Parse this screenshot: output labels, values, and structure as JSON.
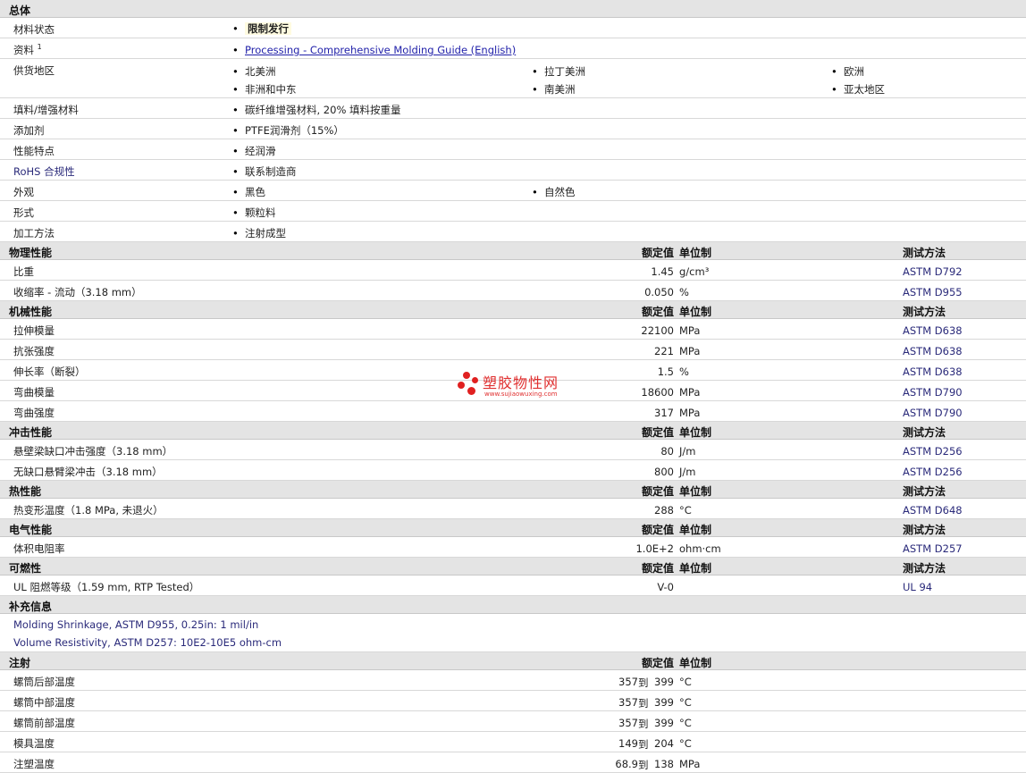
{
  "colors": {
    "section_bg": "#e4e4e4",
    "link": "#2222aa",
    "accent_text": "#2a2a7a",
    "watermark": "#e02020"
  },
  "overview": {
    "title": "总体",
    "status_label": "材料状态",
    "status_value": "限制发行",
    "docs_label": "资料",
    "docs_sup": "1",
    "docs_link": "Processing - Comprehensive Molding Guide (English)",
    "regions_label": "供货地区",
    "regions": [
      "北美洲",
      "拉丁美洲",
      "欧洲",
      "非洲和中东",
      "南美洲",
      "亚太地区"
    ],
    "filler_label": "填料/增强材料",
    "filler_value": "碳纤维增强材料, 20% 填料按重量",
    "additive_label": "添加剂",
    "additive_value": "PTFE润滑剂（15%）",
    "feature_label": "性能特点",
    "feature_value": "经润滑",
    "rohs_label": "RoHS 合规性",
    "rohs_value": "联系制造商",
    "appearance_label": "外观",
    "appearance_values": [
      "黑色",
      "自然色"
    ],
    "form_label": "形式",
    "form_value": "颗粒料",
    "process_label": "加工方法",
    "process_value": "注射成型"
  },
  "headers": {
    "value": "额定值",
    "unit": "单位制",
    "method": "测试方法"
  },
  "physical": {
    "title": "物理性能",
    "rows": [
      {
        "label": "比重",
        "value": "1.45",
        "unit": "g/cm³",
        "method": "ASTM D792"
      },
      {
        "label": "收缩率 - 流动（3.18 mm）",
        "value": "0.050",
        "unit": "%",
        "method": "ASTM D955"
      }
    ]
  },
  "mechanical": {
    "title": "机械性能",
    "rows": [
      {
        "label": "拉伸模量",
        "value": "22100",
        "unit": "MPa",
        "method": "ASTM D638"
      },
      {
        "label": "抗张强度",
        "value": "221",
        "unit": "MPa",
        "method": "ASTM D638"
      },
      {
        "label": "伸长率（断裂）",
        "value": "1.5",
        "unit": "%",
        "method": "ASTM D638"
      },
      {
        "label": "弯曲模量",
        "value": "18600",
        "unit": "MPa",
        "method": "ASTM D790"
      },
      {
        "label": "弯曲强度",
        "value": "317",
        "unit": "MPa",
        "method": "ASTM D790"
      }
    ]
  },
  "impact": {
    "title": "冲击性能",
    "rows": [
      {
        "label": "悬壁梁缺口冲击强度（3.18 mm）",
        "value": "80",
        "unit": "J/m",
        "method": "ASTM D256"
      },
      {
        "label": "无缺口悬臂梁冲击（3.18 mm）",
        "value": "800",
        "unit": "J/m",
        "method": "ASTM D256"
      }
    ]
  },
  "thermal": {
    "title": "热性能",
    "rows": [
      {
        "label": "热变形温度（1.8 MPa, 未退火）",
        "value": "288",
        "unit": "°C",
        "method": "ASTM D648"
      }
    ]
  },
  "electrical": {
    "title": "电气性能",
    "rows": [
      {
        "label": "体积电阻率",
        "value": "1.0E+2",
        "unit": "ohm·cm",
        "method": "ASTM D257"
      }
    ]
  },
  "flammability": {
    "title": "可燃性",
    "rows": [
      {
        "label": "UL 阻燃等级（1.59 mm, RTP Tested）",
        "value": "V-0",
        "unit": "",
        "method": "UL 94"
      }
    ]
  },
  "supplement": {
    "title": "补充信息",
    "notes": [
      "Molding Shrinkage, ASTM D955, 0.25in: 1 mil/in",
      "Volume Resistivity, ASTM D257: 10E2-10E5 ohm-cm"
    ]
  },
  "injection": {
    "title": "注射",
    "to": "到",
    "rows": [
      {
        "label": "螺筒后部温度",
        "low": "357",
        "high": "399",
        "unit": "°C"
      },
      {
        "label": "螺筒中部温度",
        "low": "357",
        "high": "399",
        "unit": "°C"
      },
      {
        "label": "螺筒前部温度",
        "low": "357",
        "high": "399",
        "unit": "°C"
      },
      {
        "label": "模具温度",
        "low": "149",
        "high": "204",
        "unit": "°C"
      },
      {
        "label": "注塑温度",
        "low": "68.9",
        "high": "138",
        "unit": "MPa"
      }
    ]
  },
  "watermark": {
    "cn": "塑胶物性网",
    "en": "www.sujiaowuxing.com"
  }
}
